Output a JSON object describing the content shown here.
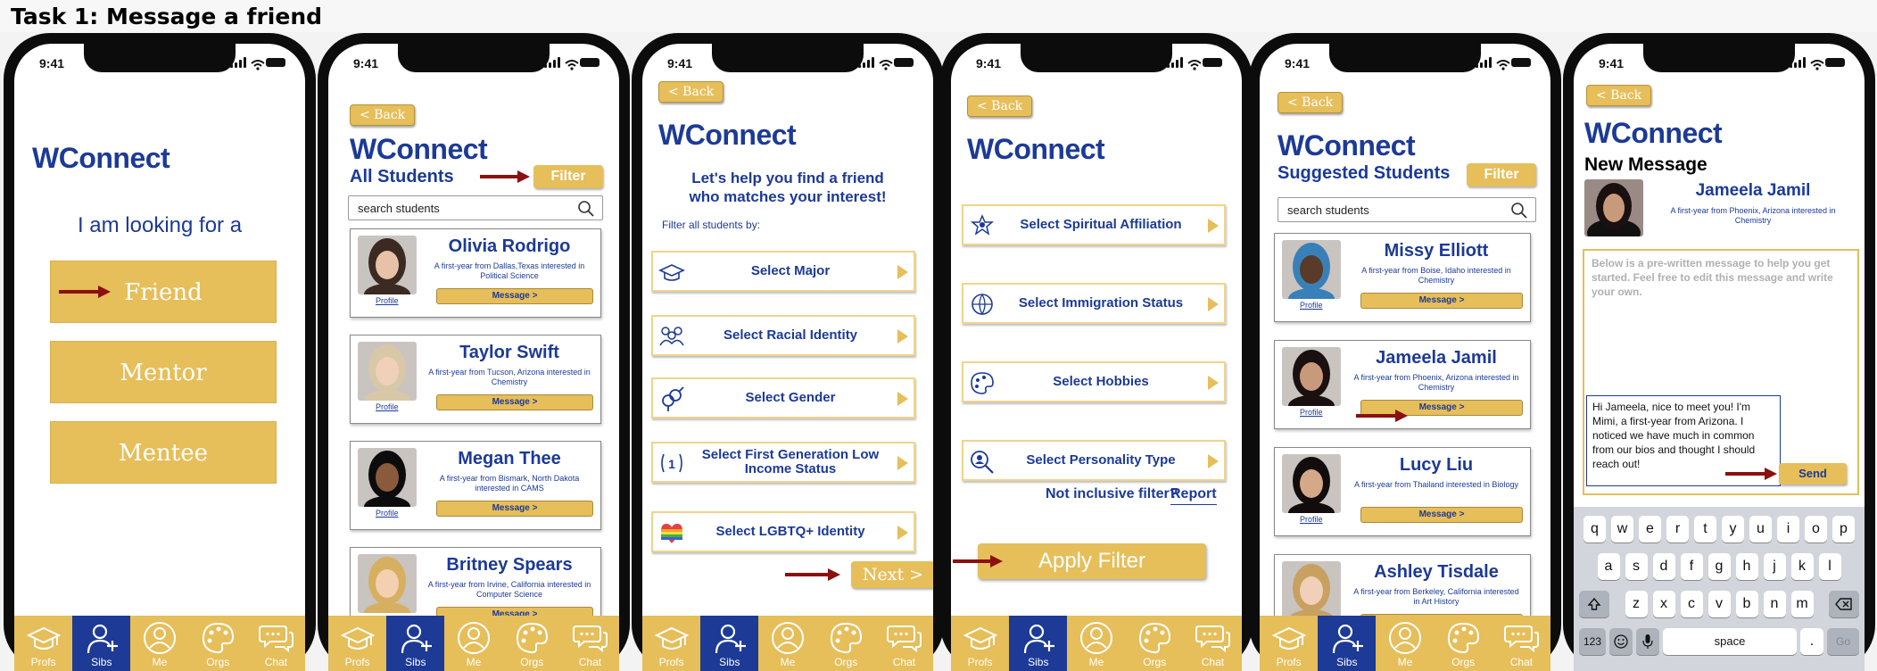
{
  "task_title": "Task 1: Message a friend",
  "status_time": "9:41",
  "tabbar": [
    {
      "label": "Profs",
      "icon": "graduation-cap-icon"
    },
    {
      "label": "Sibs",
      "icon": "add-person-icon"
    },
    {
      "label": "Me",
      "icon": "person-icon"
    },
    {
      "label": "Orgs",
      "icon": "palette-icon"
    },
    {
      "label": "Chat",
      "icon": "chat-bubbles-icon"
    }
  ],
  "common": {
    "logo": "WConnect",
    "back": "< Back",
    "filter": "Filter",
    "search_placeholder": "search students",
    "profile": "Profile",
    "message": "Message >"
  },
  "screen1": {
    "heading": "I am looking for a",
    "options": [
      "Friend",
      "Mentor",
      "Mentee"
    ]
  },
  "screen2": {
    "subtitle": "All Students",
    "students": [
      {
        "name": "Olivia Rodrigo",
        "desc": "A first-year from Dallas,Texas interested in Political Science"
      },
      {
        "name": "Taylor Swift",
        "desc": "A first-year from Tucson, Arizona interested in Chemistry"
      },
      {
        "name": "Megan Thee",
        "desc": "A first-year from Bismark, North Dakota interested in CAMS"
      },
      {
        "name": "Britney Spears",
        "desc": "A first-year from Irvine, California interested in Computer Science"
      }
    ]
  },
  "screen3": {
    "lead": "Let's help you find a friend who matches your interest!",
    "filter_label": "Filter all students by:",
    "options": [
      "Select Major",
      "Select Racial Identity",
      "Select Gender",
      "Select First Generation Low Income Status",
      "Select LGBTQ+ Identity"
    ],
    "next": "Next >"
  },
  "screen4": {
    "options": [
      "Select Spiritual Affiliation",
      "Select Immigration Status",
      "Select Hobbies",
      "Select Personality Type"
    ],
    "not_inclusive": "Not inclusive filter?",
    "report": "Report",
    "apply": "Apply Filter"
  },
  "screen5": {
    "subtitle": "Suggested Students",
    "students": [
      {
        "name": "Missy Elliott",
        "desc": "A first-year from Boise, Idaho interested in Chemistry"
      },
      {
        "name": "Jameela Jamil",
        "desc": "A first-year from Phoenix, Arizona interested in Chemistry"
      },
      {
        "name": "Lucy Liu",
        "desc": "A first-year from Thailand interested in Biology"
      },
      {
        "name": "Ashley Tisdale",
        "desc": "A first-year from Berkeley, California interested in Art History"
      }
    ]
  },
  "screen6": {
    "title": "New Message",
    "recipient_name": "Jameela Jamil",
    "recipient_desc": "A first-year from Phoenix, Arizona interested in Chemistry",
    "hint": "Below is a pre-written message to help you get started. Feel free to edit this message and write your own.",
    "draft": "Hi Jameela, nice to meet you! I'm Mimi, a first-year from Arizona. I noticed we have much in common from our bios and thought I should reach out!",
    "send": "Send",
    "keyboard_rows": [
      [
        "q",
        "w",
        "e",
        "r",
        "t",
        "y",
        "u",
        "i",
        "o",
        "p"
      ],
      [
        "a",
        "s",
        "d",
        "f",
        "g",
        "h",
        "j",
        "k",
        "l"
      ],
      [
        "z",
        "x",
        "c",
        "v",
        "b",
        "n",
        "m"
      ]
    ],
    "key_123": "123",
    "key_space": "space",
    "key_dot": ".",
    "key_go": "Go"
  }
}
